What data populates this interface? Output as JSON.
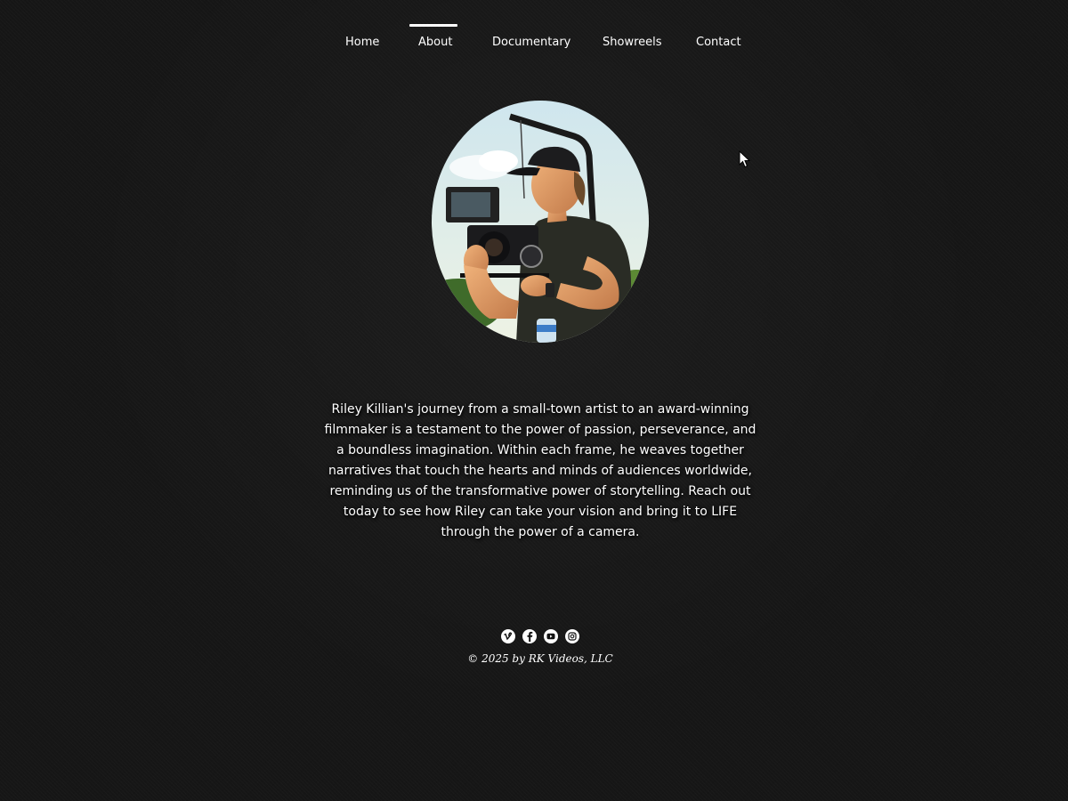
{
  "nav": {
    "items": [
      {
        "label": "Home"
      },
      {
        "label": "About",
        "active": true
      },
      {
        "label": "Documentary"
      },
      {
        "label": "Showreels"
      },
      {
        "label": "Contact"
      }
    ]
  },
  "about": {
    "bio": "Riley Killian's journey from a small-town artist to an award-winning filmmaker is a testament to the power of passion, perseverance, and a boundless imagination. Within each frame, he weaves together narratives that touch the hearts and minds of audiences worldwide, reminding us of the transformative power of storytelling. Reach out today to see how Riley can take your vision and bring it to LIFE through the power of a camera."
  },
  "footer": {
    "social": [
      {
        "icon": "vimeo-icon"
      },
      {
        "icon": "facebook-icon"
      },
      {
        "icon": "youtube-icon"
      },
      {
        "icon": "instagram-icon"
      }
    ],
    "copyright": "© 2025 by RK Videos, LLC"
  },
  "colors": {
    "background": "#161616",
    "text": "#ffffff"
  }
}
